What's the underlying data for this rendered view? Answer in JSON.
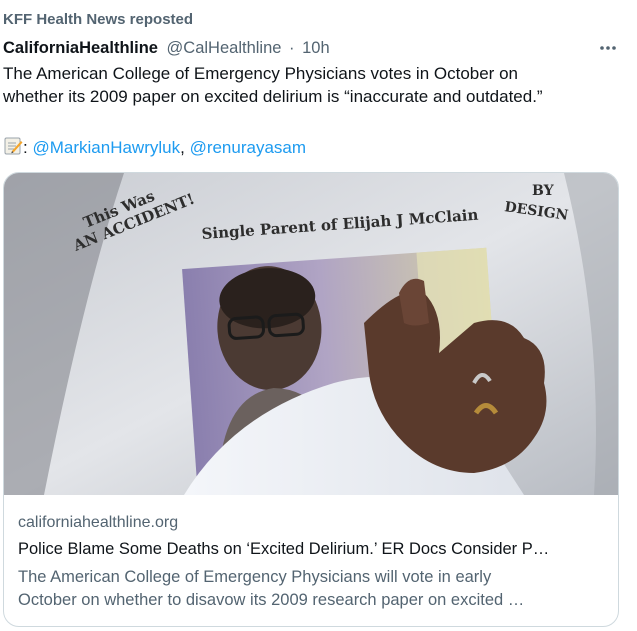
{
  "repost": {
    "label": "KFF Health News reposted"
  },
  "post": {
    "display_name": "CaliforniaHealthline",
    "handle": "@CalHealthline",
    "separator": "·",
    "time": "10h",
    "more_icon": "more-horizontal-icon",
    "text_line1": "The American College of Emergency Physicians votes in October on",
    "text_line2": "whether its 2009 paper on excited delirium is “inaccurate and outdated.”",
    "credits_icon": "memo-icon",
    "credits_separator": ":",
    "mention1": "@MarkianHawryluk",
    "mention_separator": ",",
    "mention2": "@renurayasam"
  },
  "card": {
    "image_shirt_text_left_1": "This Was",
    "image_shirt_text_left_2": "AN ACCIDENT!",
    "image_shirt_text_center": "Single Parent of Elijah J McClain",
    "image_shirt_text_right_1": "BY",
    "image_shirt_text_right_2": "DESIGN",
    "domain": "californiahealthline.org",
    "title": "Police Blame Some Deaths on ‘Excited Delirium.’ ER Docs Consider P…",
    "description_line1": "The American College of Emergency Physicians will vote in early",
    "description_line2": "October on whether to disavow its 2009 research paper on excited …"
  },
  "colors": {
    "text_primary": "#0f1419",
    "text_secondary": "#536471",
    "link": "#1d9bf0",
    "border": "#cfd9de"
  }
}
